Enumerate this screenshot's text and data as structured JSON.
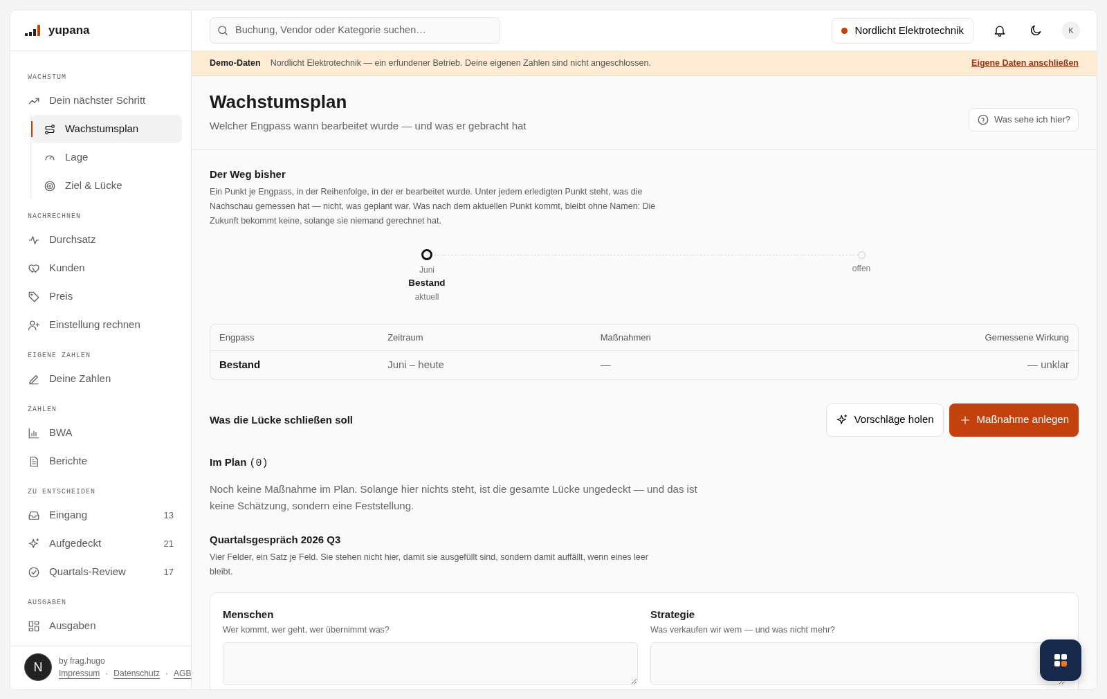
{
  "brand": {
    "name": "yupana"
  },
  "sidebar": {
    "sections": [
      {
        "title": "WACHSTUM",
        "items": [
          {
            "label": "Dein nächster Schritt",
            "selected": false,
            "children": [
              {
                "label": "Wachstumsplan",
                "selected": true
              },
              {
                "label": "Lage",
                "selected": false
              },
              {
                "label": "Ziel & Lücke",
                "selected": false
              }
            ]
          }
        ]
      },
      {
        "title": "NACHRECHNEN",
        "items": [
          {
            "label": "Durchsatz",
            "selected": false
          },
          {
            "label": "Kunden",
            "selected": false
          },
          {
            "label": "Preis",
            "selected": false
          },
          {
            "label": "Einstellung rechnen",
            "selected": false
          }
        ]
      },
      {
        "title": "EIGENE ZAHLEN",
        "items": [
          {
            "label": "Deine Zahlen",
            "selected": false
          }
        ]
      },
      {
        "title": "ZAHLEN",
        "items": [
          {
            "label": "BWA",
            "selected": false
          },
          {
            "label": "Berichte",
            "selected": false
          }
        ]
      },
      {
        "title": "ZU ENTSCHEIDEN",
        "items": [
          {
            "label": "Eingang",
            "selected": false,
            "count": "13"
          },
          {
            "label": "Aufgedeckt",
            "selected": false,
            "count": "21"
          },
          {
            "label": "Quartals-Review",
            "selected": false,
            "count": "17"
          }
        ]
      },
      {
        "title": "AUSGABEN",
        "items": [
          {
            "label": "Ausgaben",
            "selected": false
          }
        ]
      }
    ],
    "footer": {
      "byline": "by frag.hugo",
      "links": [
        "Impressum",
        "Datenschutz",
        "AGB"
      ],
      "separator": "·",
      "badge": "N"
    }
  },
  "topbar": {
    "search": {
      "placeholder": "Buchung, Vendor oder Kategorie suchen…"
    },
    "company": {
      "name": "Nordlicht Elektrotechnik",
      "color": "#c2410c"
    },
    "avatar": "K"
  },
  "banner": {
    "label": "Demo-Daten",
    "text": "Nordlicht Elektrotechnik — ein erfundener Betrieb. Deine eigenen Zahlen sind nicht angeschlossen.",
    "link": "Eigene Daten anschließen"
  },
  "header": {
    "title": "Wachstumsplan",
    "subtitle": "Welcher Engpass wann bearbeitet wurde — und was er gebracht hat",
    "help": "Was sehe ich hier?"
  },
  "path": {
    "title": "Der Weg bisher",
    "text": "Ein Punkt je Engpass, in der Reihenfolge, in der er bearbeitet wurde. Unter jedem erledigten Punkt steht, was die Nachschau gemessen hat — nicht, was geplant war. Was nach dem aktuellen Punkt kommt, bleibt ohne Namen: Die Zukunft bekommt keine, solange sie niemand gerechnet hat.",
    "timeline": [
      {
        "kind": "current",
        "month": "Juni",
        "name": "Bestand",
        "status": "aktuell"
      },
      {
        "kind": "open",
        "month": "offen"
      }
    ],
    "table": {
      "columns": [
        "Engpass",
        "Zeitraum",
        "Maßnahmen",
        "Gemessene Wirkung"
      ],
      "rows": [
        [
          "Bestand",
          "Juni – heute",
          "—",
          "— unklar"
        ]
      ]
    }
  },
  "measures": {
    "title": "Was die Lücke schließen soll",
    "buttons": [
      {
        "kind": "secondary",
        "label": "Vorschläge holen"
      },
      {
        "kind": "primary",
        "label": "Maßnahme anlegen"
      }
    ],
    "plan_title": "Im Plan",
    "plan_count": "(0)",
    "empty": "Noch keine Maßnahme im Plan. Solange hier nichts steht, ist die gesamte Lücke ungedeckt — und das ist keine Schätzung, sondern eine Feststellung."
  },
  "review": {
    "title": "Quartalsgespräch 2026 Q3",
    "text": "Vier Felder, ein Satz je Feld. Sie stehen nicht hier, damit sie ausgefüllt sind, sondern damit auffällt, wenn eines leer bleibt.",
    "fields": [
      {
        "label": "Menschen",
        "hint": "Wer kommt, wer geht, wer übernimmt was?"
      },
      {
        "label": "Strategie",
        "hint": "Was verkaufen wir wem — und was nicht mehr?"
      }
    ]
  }
}
